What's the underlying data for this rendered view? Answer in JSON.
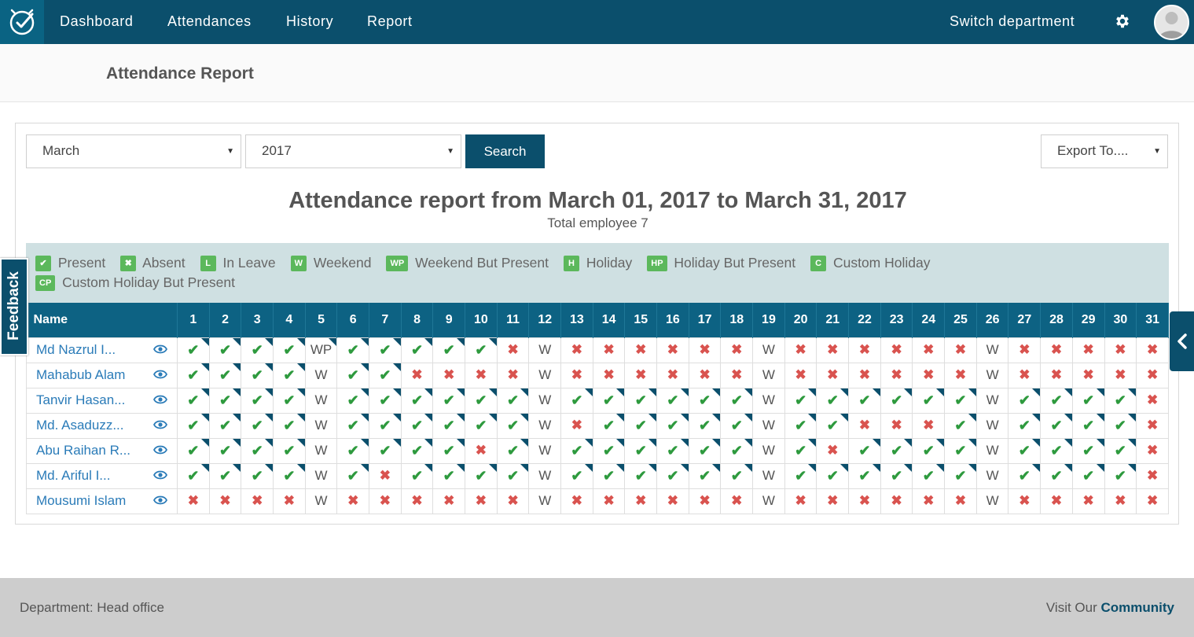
{
  "nav": {
    "items": [
      "Dashboard",
      "Attendances",
      "History",
      "Report"
    ],
    "switch_department": "Switch department"
  },
  "page": {
    "title": "Attendance Report"
  },
  "filters": {
    "month": "March",
    "year": "2017",
    "search_label": "Search",
    "export_label": "Export To...."
  },
  "report": {
    "title": "Attendance report from March 01, 2017 to March 31, 2017",
    "subtitle": "Total employee 7"
  },
  "legend": [
    {
      "badge": "✔",
      "label": "Present"
    },
    {
      "badge": "✖",
      "label": "Absent"
    },
    {
      "badge": "L",
      "label": "In Leave"
    },
    {
      "badge": "W",
      "label": "Weekend"
    },
    {
      "badge": "WP",
      "label": "Weekend But Present"
    },
    {
      "badge": "H",
      "label": "Holiday"
    },
    {
      "badge": "HP",
      "label": "Holiday But Present"
    },
    {
      "badge": "C",
      "label": "Custom Holiday"
    },
    {
      "badge": "CP",
      "label": "Custom Holiday But Present"
    }
  ],
  "table": {
    "name_header": "Name",
    "days": [
      "1",
      "2",
      "3",
      "4",
      "5",
      "6",
      "7",
      "8",
      "9",
      "10",
      "11",
      "12",
      "13",
      "14",
      "15",
      "16",
      "17",
      "18",
      "19",
      "20",
      "21",
      "22",
      "23",
      "24",
      "25",
      "26",
      "27",
      "28",
      "29",
      "30",
      "31"
    ],
    "rows": [
      {
        "name": "Md Nazrul I...",
        "days": [
          "P",
          "P",
          "P",
          "P",
          "WP",
          "P",
          "P",
          "P",
          "P",
          "P",
          "A",
          "W",
          "A",
          "A",
          "A",
          "A",
          "A",
          "A",
          "W",
          "A",
          "A",
          "A",
          "A",
          "A",
          "A",
          "W",
          "A",
          "A",
          "A",
          "A",
          "A"
        ],
        "flags": [
          1,
          1,
          1,
          1,
          1,
          1,
          1,
          1,
          1,
          1,
          0,
          0,
          0,
          0,
          0,
          0,
          0,
          0,
          0,
          0,
          0,
          0,
          0,
          0,
          0,
          0,
          0,
          0,
          0,
          0,
          0
        ]
      },
      {
        "name": "Mahabub Alam",
        "days": [
          "P",
          "P",
          "P",
          "P",
          "W",
          "P",
          "P",
          "A",
          "A",
          "A",
          "A",
          "W",
          "A",
          "A",
          "A",
          "A",
          "A",
          "A",
          "W",
          "A",
          "A",
          "A",
          "A",
          "A",
          "A",
          "W",
          "A",
          "A",
          "A",
          "A",
          "A"
        ],
        "flags": [
          1,
          1,
          1,
          1,
          0,
          1,
          1,
          0,
          0,
          0,
          0,
          0,
          0,
          0,
          0,
          0,
          0,
          0,
          0,
          0,
          0,
          0,
          0,
          0,
          0,
          0,
          0,
          0,
          0,
          0,
          0
        ]
      },
      {
        "name": "Tanvir Hasan...",
        "days": [
          "P",
          "P",
          "P",
          "P",
          "W",
          "P",
          "P",
          "P",
          "P",
          "P",
          "P",
          "W",
          "P",
          "P",
          "P",
          "P",
          "P",
          "P",
          "W",
          "P",
          "P",
          "P",
          "P",
          "P",
          "P",
          "W",
          "P",
          "P",
          "P",
          "P",
          "A"
        ],
        "flags": [
          1,
          1,
          1,
          1,
          0,
          1,
          1,
          1,
          1,
          1,
          1,
          0,
          1,
          1,
          1,
          1,
          1,
          1,
          0,
          1,
          1,
          1,
          1,
          1,
          1,
          0,
          1,
          1,
          1,
          1,
          0
        ]
      },
      {
        "name": "Md. Asaduzz...",
        "days": [
          "P",
          "P",
          "P",
          "P",
          "W",
          "P",
          "P",
          "P",
          "P",
          "P",
          "P",
          "W",
          "A",
          "P",
          "P",
          "P",
          "P",
          "P",
          "W",
          "P",
          "P",
          "A",
          "A",
          "A",
          "P",
          "W",
          "P",
          "P",
          "P",
          "P",
          "A"
        ],
        "flags": [
          1,
          1,
          1,
          1,
          0,
          1,
          1,
          1,
          1,
          1,
          1,
          0,
          0,
          1,
          1,
          1,
          1,
          1,
          0,
          1,
          1,
          0,
          0,
          0,
          1,
          0,
          1,
          1,
          1,
          1,
          0
        ]
      },
      {
        "name": "Abu Raihan R...",
        "days": [
          "P",
          "P",
          "P",
          "P",
          "W",
          "P",
          "P",
          "P",
          "P",
          "A",
          "P",
          "W",
          "P",
          "P",
          "P",
          "P",
          "P",
          "P",
          "W",
          "P",
          "A",
          "P",
          "P",
          "P",
          "P",
          "W",
          "P",
          "P",
          "P",
          "P",
          "A"
        ],
        "flags": [
          1,
          1,
          1,
          1,
          0,
          1,
          1,
          1,
          1,
          0,
          1,
          0,
          1,
          1,
          1,
          1,
          1,
          1,
          0,
          1,
          0,
          1,
          1,
          1,
          1,
          0,
          1,
          1,
          1,
          1,
          0
        ]
      },
      {
        "name": "Md. Ariful I...",
        "days": [
          "P",
          "P",
          "P",
          "P",
          "W",
          "P",
          "A",
          "P",
          "P",
          "P",
          "P",
          "W",
          "P",
          "P",
          "P",
          "P",
          "P",
          "P",
          "W",
          "P",
          "P",
          "P",
          "P",
          "P",
          "P",
          "W",
          "P",
          "P",
          "P",
          "P",
          "A"
        ],
        "flags": [
          1,
          1,
          1,
          1,
          0,
          1,
          0,
          1,
          1,
          1,
          1,
          0,
          1,
          1,
          1,
          1,
          1,
          1,
          0,
          1,
          1,
          1,
          1,
          1,
          1,
          0,
          1,
          1,
          1,
          1,
          0
        ]
      },
      {
        "name": "Mousumi Islam",
        "days": [
          "A",
          "A",
          "A",
          "A",
          "W",
          "A",
          "A",
          "A",
          "A",
          "A",
          "A",
          "W",
          "A",
          "A",
          "A",
          "A",
          "A",
          "A",
          "W",
          "A",
          "A",
          "A",
          "A",
          "A",
          "A",
          "W",
          "A",
          "A",
          "A",
          "A",
          "A"
        ],
        "flags": [
          0,
          0,
          0,
          0,
          0,
          0,
          0,
          0,
          0,
          0,
          0,
          0,
          0,
          0,
          0,
          0,
          0,
          0,
          0,
          0,
          0,
          0,
          0,
          0,
          0,
          0,
          0,
          0,
          0,
          0,
          0
        ]
      }
    ]
  },
  "feedback": "Feedback",
  "footer": {
    "department": "Department: Head office",
    "visit_prefix": "Visit Our",
    "visit_link": "Community"
  },
  "icons": {
    "logo": "clock-check-icon",
    "settings": "gear-icon",
    "view": "eye-icon",
    "present": "check-icon",
    "absent": "cross-icon",
    "side_tab": "chevron-left-icon"
  },
  "colors": {
    "navbar": "#0b4f6c",
    "table_header": "#0d6283",
    "legend_bg": "#cfe0e2",
    "present": "#2e9a3e",
    "absent": "#d9534f",
    "badge": "#5cb85c",
    "link": "#2a7bb8"
  }
}
